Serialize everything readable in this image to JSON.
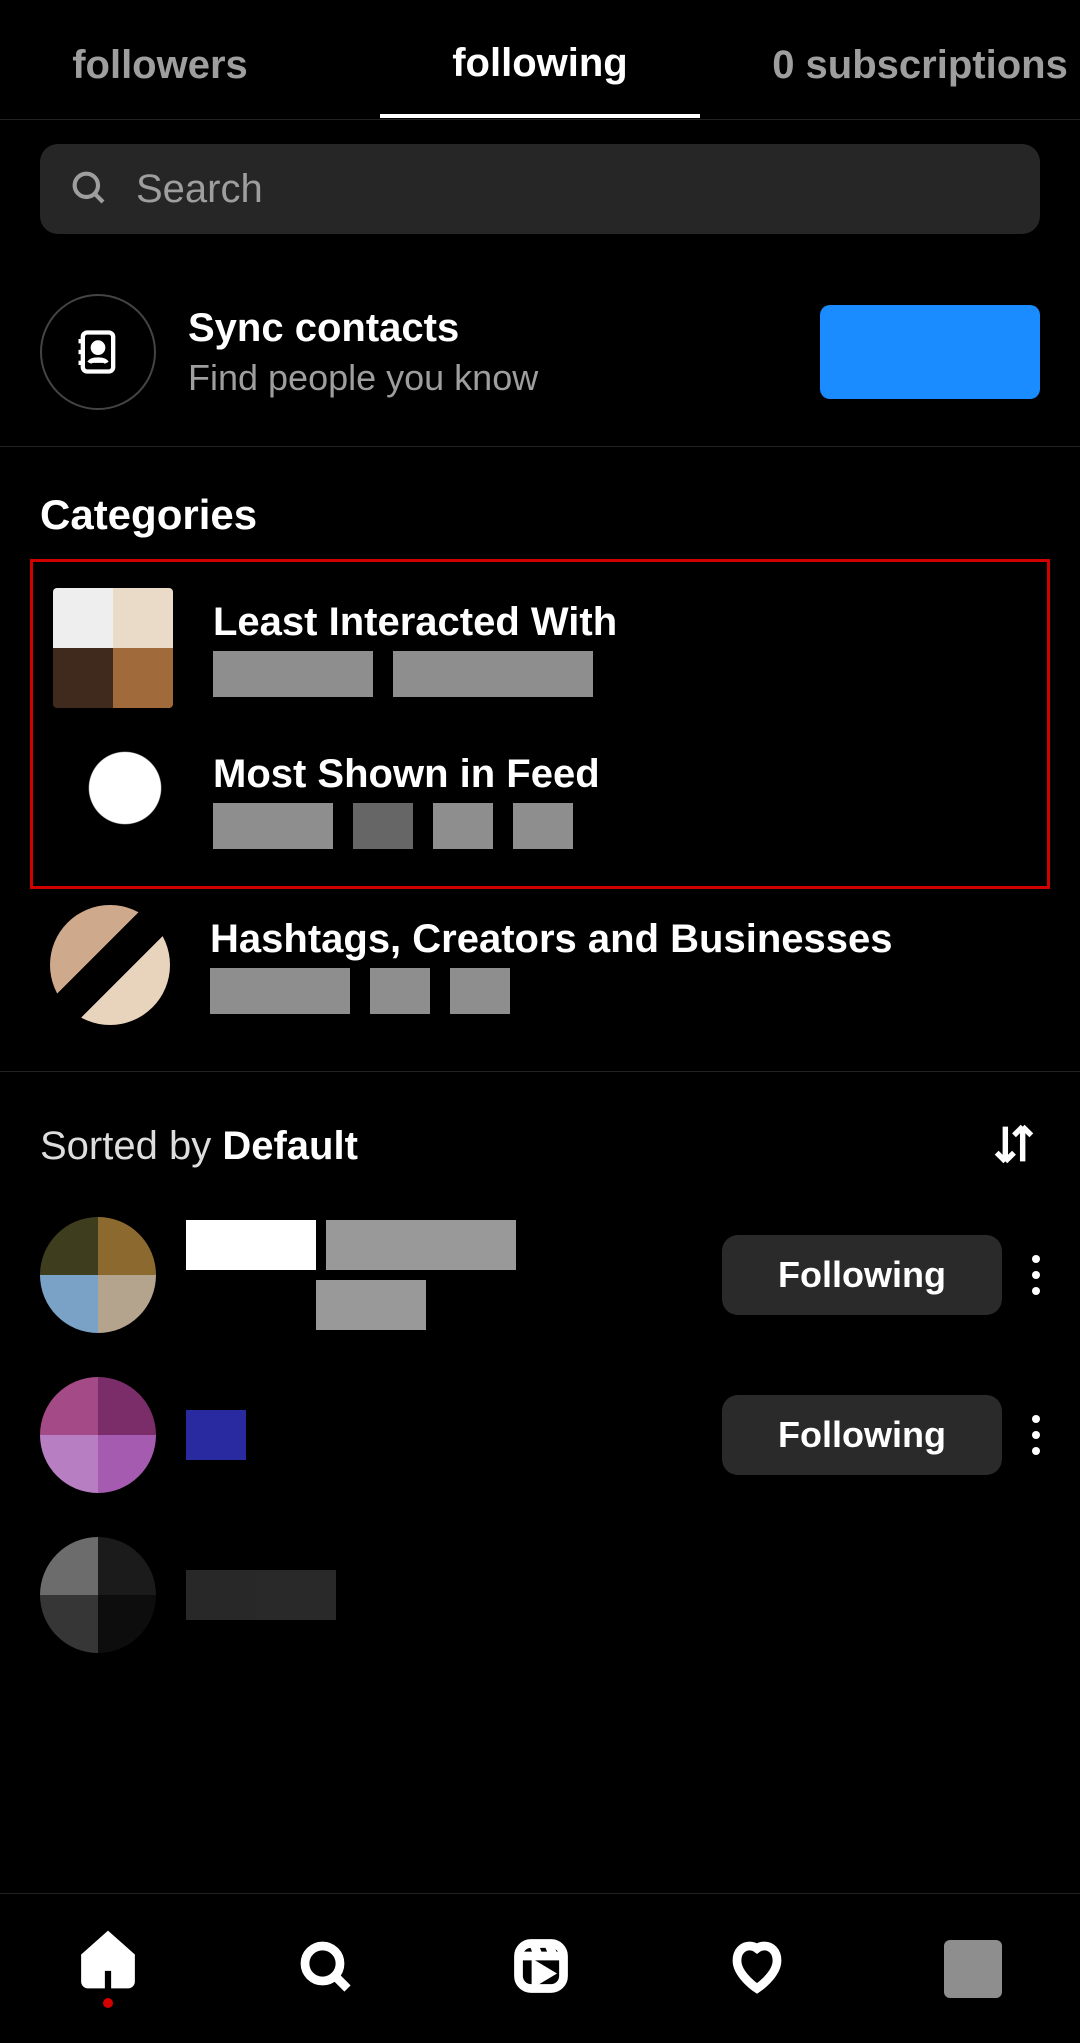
{
  "tabs": {
    "followers": "followers",
    "following": "following",
    "subscriptions": "0 subscriptions"
  },
  "search": {
    "placeholder": "Search"
  },
  "sync": {
    "title": "Sync contacts",
    "subtitle": "Find people you know"
  },
  "categories": {
    "heading": "Categories",
    "least": {
      "title": "Least Interacted With"
    },
    "most": {
      "title": "Most Shown in Feed"
    },
    "hash": {
      "title": "Hashtags, Creators and Businesses"
    }
  },
  "sorted": {
    "prefix": "Sorted by ",
    "value": "Default"
  },
  "follow_btn": "Following"
}
